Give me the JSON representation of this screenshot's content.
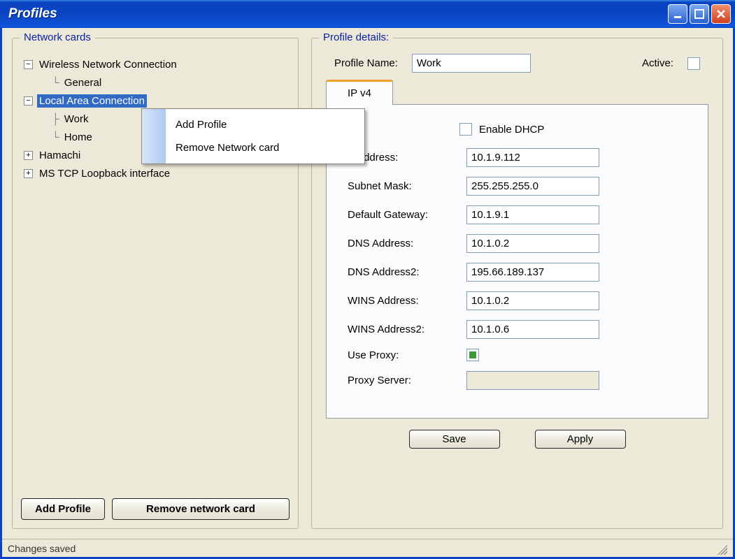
{
  "window": {
    "title": "Profiles"
  },
  "left": {
    "title": "Network cards",
    "tree": {
      "wireless": "Wireless Network Connection",
      "wireless_general": "General",
      "lan": "Local Area Connection",
      "lan_work": "Work",
      "lan_home": "Home",
      "hamachi": "Hamachi",
      "loopback": "MS TCP Loopback interface"
    },
    "buttons": {
      "add_profile": "Add Profile",
      "remove_card": "Remove network card"
    }
  },
  "context_menu": {
    "add_profile": "Add Profile",
    "remove_card": "Remove Network card"
  },
  "right": {
    "title": "Profile details:",
    "profile_name_label": "Profile Name:",
    "profile_name_value": "Work",
    "active_label": "Active:",
    "tab_label": "IP v4",
    "enable_dhcp_label": "Enable DHCP",
    "fields": {
      "ip_label": "IPAddress:",
      "ip_value": "10.1.9.112",
      "subnet_label": "Subnet Mask:",
      "subnet_value": "255.255.255.0",
      "gateway_label": "Default Gateway:",
      "gateway_value": "10.1.9.1",
      "dns1_label": "DNS Address:",
      "dns1_value": "10.1.0.2",
      "dns2_label": "DNS Address2:",
      "dns2_value": "195.66.189.137",
      "wins1_label": "WINS Address:",
      "wins1_value": "10.1.0.2",
      "wins2_label": "WINS Address2:",
      "wins2_value": "10.1.0.6",
      "use_proxy_label": "Use Proxy:",
      "proxy_server_label": "Proxy Server:"
    },
    "buttons": {
      "save": "Save",
      "apply": "Apply"
    }
  },
  "status": {
    "text": "Changes saved"
  }
}
